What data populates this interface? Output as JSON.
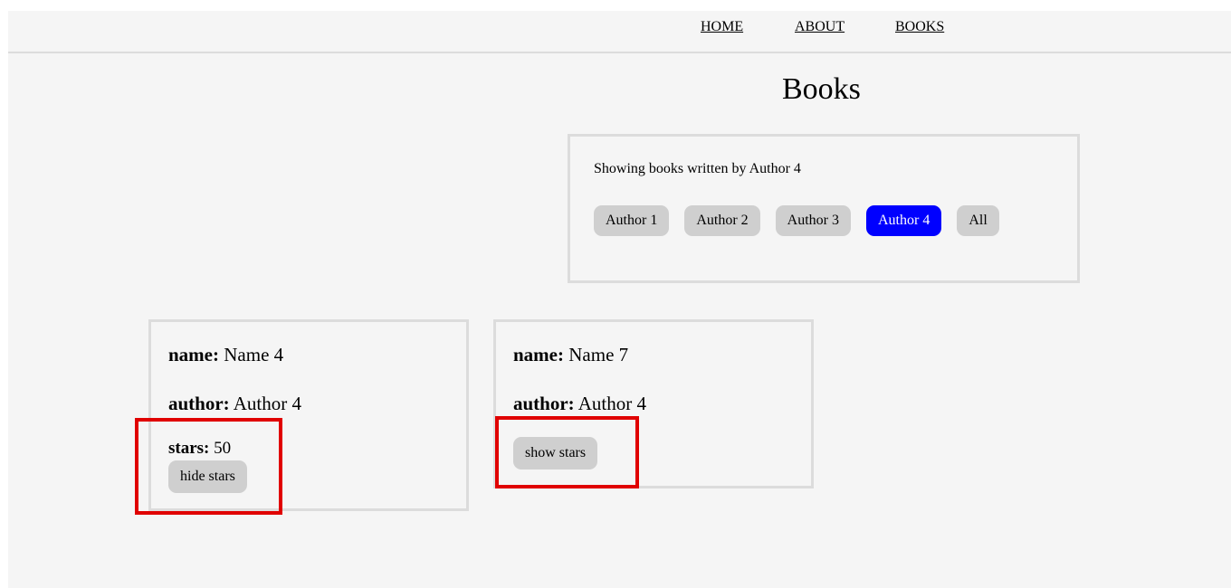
{
  "nav": {
    "links": [
      "HOME",
      "ABOUT",
      "BOOKS"
    ]
  },
  "page": {
    "title": "Books"
  },
  "filter": {
    "status_text": "Showing books written by Author 4",
    "buttons": [
      "Author 1",
      "Author 2",
      "Author 3",
      "Author 4",
      "All"
    ],
    "selected": "Author 4",
    "active_color": "#0000ff"
  },
  "books": [
    {
      "name_label": "name:",
      "name": "Name 4",
      "author_label": "author:",
      "author": "Author 4",
      "stars_label": "stars:",
      "stars": "50",
      "toggle_label": "hide stars"
    },
    {
      "name_label": "name:",
      "name": "Name 7",
      "author_label": "author:",
      "author": "Author 4",
      "toggle_label": "show stars"
    }
  ],
  "annotation": {
    "highlight_color": "#e00000"
  }
}
